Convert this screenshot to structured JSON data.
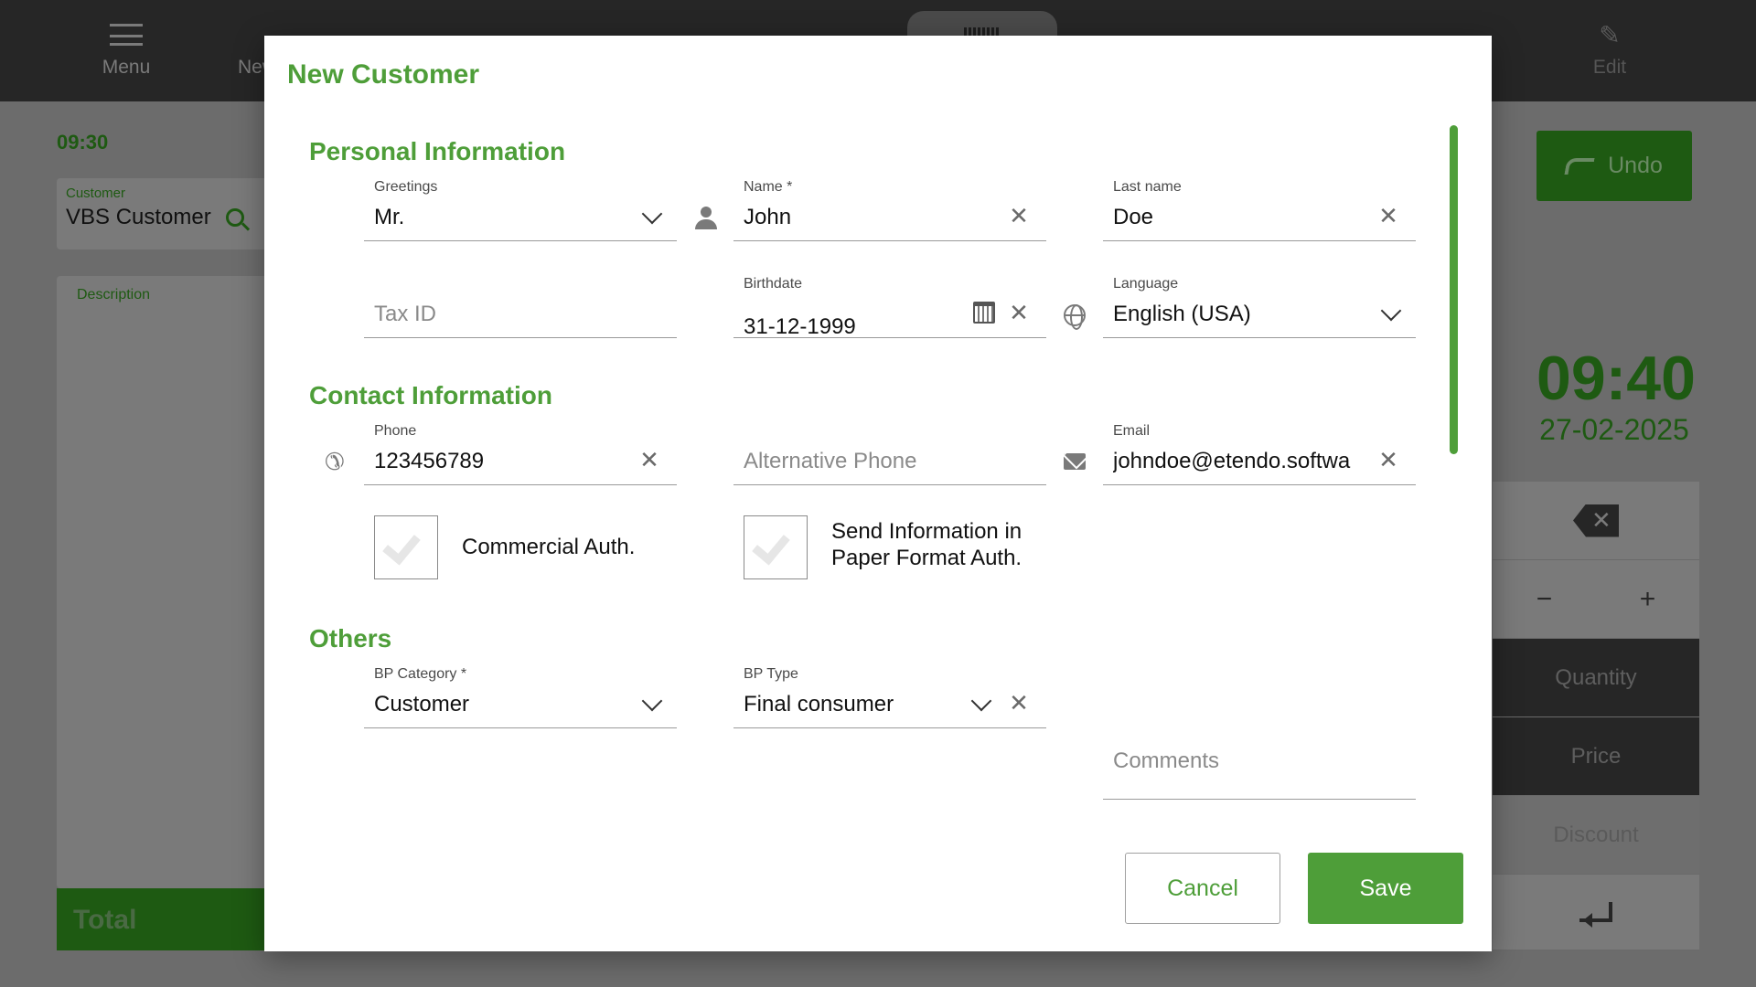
{
  "background": {
    "topbar": {
      "menu_label": "Menu",
      "new_label": "New",
      "edit_label": "Edit"
    },
    "time_small": "09:30",
    "customer": {
      "label": "Customer",
      "value": "VBS Customer"
    },
    "description_label": "Description",
    "total_label": "Total",
    "undo_label": "Undo",
    "clock": "09:40",
    "date": "27-02-2025",
    "keypad": {
      "minus": "−",
      "plus": "+",
      "quantity": "Quantity",
      "price": "Price",
      "discount": "Discount"
    }
  },
  "modal": {
    "title": "New Customer",
    "sections": {
      "personal": "Personal Information",
      "contact": "Contact Information",
      "others": "Others"
    },
    "fields": {
      "greetings": {
        "label": "Greetings",
        "value": "Mr."
      },
      "name": {
        "label": "Name *",
        "value": "John"
      },
      "last_name": {
        "label": "Last name",
        "value": "Doe"
      },
      "tax_id": {
        "placeholder": "Tax ID"
      },
      "birthdate": {
        "label": "Birthdate",
        "value": "31-12-1999"
      },
      "language": {
        "label": "Language",
        "value": "English (USA)"
      },
      "phone": {
        "label": "Phone",
        "value": "123456789"
      },
      "alt_phone": {
        "placeholder": "Alternative Phone"
      },
      "email": {
        "label": "Email",
        "value": "johndoe@etendo.softwa"
      },
      "bp_category": {
        "label": "BP Category *",
        "value": "Customer"
      },
      "bp_type": {
        "label": "BP Type",
        "value": "Final consumer"
      },
      "comments": {
        "placeholder": "Comments"
      }
    },
    "checkboxes": {
      "commercial_auth": "Commercial Auth.",
      "paper_auth_line1": "Send Information in",
      "paper_auth_line2": "Paper Format Auth."
    },
    "buttons": {
      "cancel": "Cancel",
      "save": "Save"
    }
  },
  "icons": {
    "person": "person-icon",
    "globe": "globe-icon",
    "phone": "phone-icon",
    "mail": "mail-icon",
    "calendar": "calendar-icon",
    "clear": "close-icon",
    "dropdown": "chevron-down-icon"
  },
  "colors": {
    "accent": "#4e9e39",
    "dim_accent": "#1e5a12"
  }
}
